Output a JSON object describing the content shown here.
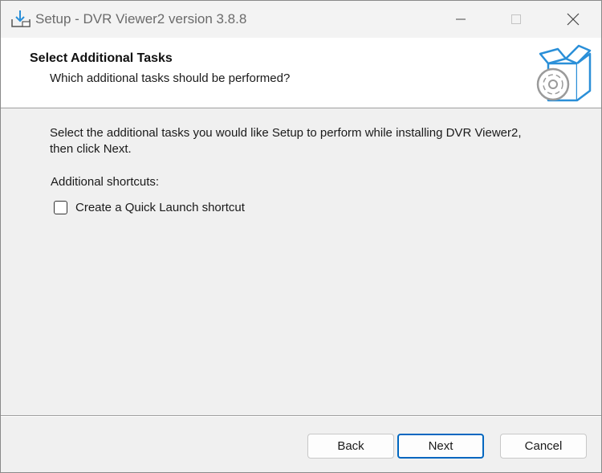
{
  "window": {
    "title": "Setup - DVR Viewer2 version 3.8.8",
    "icons": {
      "app": "setup-download-icon",
      "minimize": "minimize-icon",
      "maximize": "maximize-icon",
      "close": "close-icon"
    }
  },
  "header": {
    "title": "Select Additional Tasks",
    "subtitle": "Which additional tasks should be performed?",
    "icon": "software-box-disc-icon"
  },
  "body": {
    "description": "Select the additional tasks you would like Setup to perform while installing DVR Viewer2, then click Next.",
    "shortcuts_label": "Additional shortcuts:",
    "tasks": [
      {
        "label": "Create a Quick Launch shortcut",
        "checked": false
      }
    ]
  },
  "buttons": {
    "back": "Back",
    "next": "Next",
    "cancel": "Cancel"
  },
  "colors": {
    "accent": "#0067c0",
    "header_bg": "#ffffff",
    "body_bg": "#f0f0f0",
    "icon_blue": "#2a8fd8"
  }
}
